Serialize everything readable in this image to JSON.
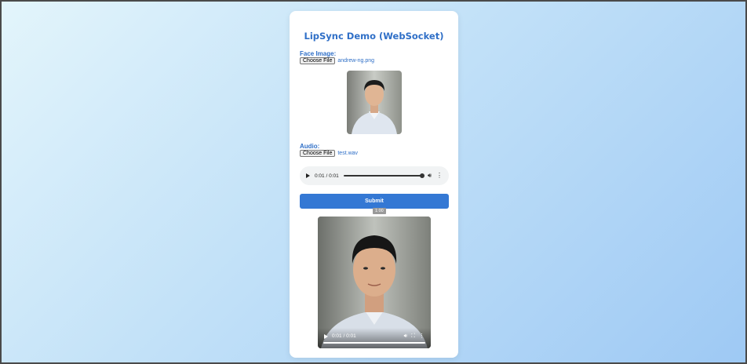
{
  "page": {
    "title": "LipSync Demo (WebSocket)"
  },
  "face": {
    "label": "Face Image:",
    "choose_label": "Choose File",
    "filename": "andrew-ng.png"
  },
  "audio": {
    "label": "Audio:",
    "choose_label": "Choose File",
    "filename": "test.wav",
    "time": "0:01 / 0:01",
    "progress": 1.0
  },
  "submit": {
    "label": "Submit",
    "tooltip": "1:00"
  },
  "video": {
    "time": "0:01 / 0:01",
    "progress": 1.0
  },
  "colors": {
    "accent": "#3478d4",
    "label": "#2f6fc7"
  }
}
